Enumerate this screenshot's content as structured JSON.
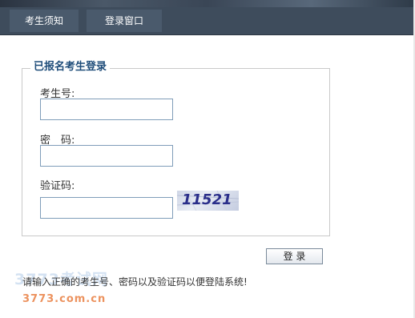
{
  "nav": {
    "tabs": [
      {
        "label": "考生须知"
      },
      {
        "label": "登录窗口"
      }
    ]
  },
  "login": {
    "legend": "已报名考生登录",
    "fields": {
      "exam_id_label": "考生号:",
      "exam_id_value": "",
      "password_label": "密　码:",
      "password_value": "",
      "captcha_label": "验证码:",
      "captcha_value": ""
    },
    "captcha_image_text": "11521",
    "submit_label": "登 录",
    "hint": "请输入正确的考生号、密码以及验证码以便登陆系统!"
  },
  "watermark": {
    "top": "3773考试网",
    "bottom": "3773.com.cn"
  },
  "colors": {
    "nav_bg": "#3e4c5c",
    "legend": "#1f4d7a",
    "input_border": "#7f9db9",
    "captcha_text": "#2a2e8a",
    "watermark_orange": "#e66e28"
  },
  "icons": {
    "captcha": "captcha-image"
  }
}
